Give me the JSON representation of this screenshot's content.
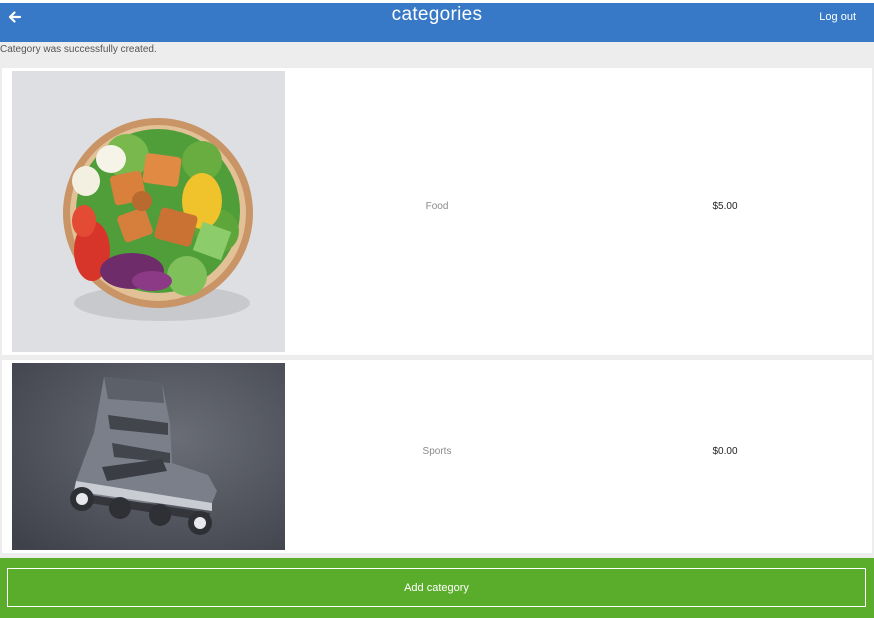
{
  "header": {
    "title": "categories",
    "logout_label": "Log out",
    "back_icon": "arrow-left-icon"
  },
  "flash_message": "Category was successfully created.",
  "categories": [
    {
      "name": "Food",
      "price": "$5.00",
      "image": "salad-bowl-photo"
    },
    {
      "name": "Sports",
      "price": "$0.00",
      "image": "inline-skate-photo"
    }
  ],
  "footer": {
    "add_label": "Add category"
  },
  "colors": {
    "header_bg": "#3778c7",
    "footer_bg": "#5aad2a",
    "list_bg": "#ededed"
  }
}
